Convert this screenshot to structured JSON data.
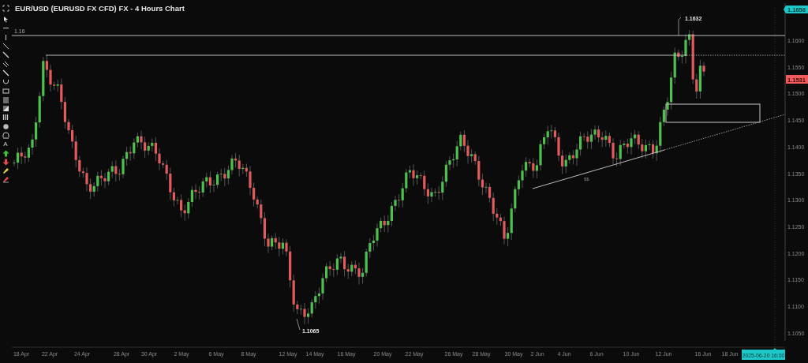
{
  "title": "EUR/USD (EURUSD FX CFD) FX - 4 Hours Chart",
  "toolbar": {
    "text_tool": "A"
  },
  "chart": {
    "top_price": "1.1658",
    "last_price": "1.1531",
    "cursor_time": "2025-06-20 16:00",
    "price_labels": [
      "1.1600",
      "1.1550",
      "1.1500",
      "1.1450",
      "1.1400",
      "1.1350",
      "1.1300",
      "1.1250",
      "1.1200",
      "1.1150",
      "1.1100",
      "1.1050"
    ],
    "time_labels": [
      "18 Apr",
      "22 Apr",
      "24 Apr",
      "28 Apr",
      "30 Apr",
      "2 May",
      "6 May",
      "8 May",
      "12 May",
      "14 May",
      "16 May",
      "20 May",
      "22 May",
      "26 May",
      "28 May",
      "30 May",
      "2 Jun",
      "4 Jun",
      "6 Jun",
      "10 Jun",
      "12 Jun",
      "16 Jun",
      "18 Jun"
    ],
    "annotations": [
      {
        "kind": "level",
        "text": "1.16"
      },
      {
        "kind": "high",
        "text": "1.1632"
      },
      {
        "kind": "low",
        "text": "1.1065"
      },
      {
        "kind": "liquidity",
        "text": "$$"
      }
    ]
  }
}
